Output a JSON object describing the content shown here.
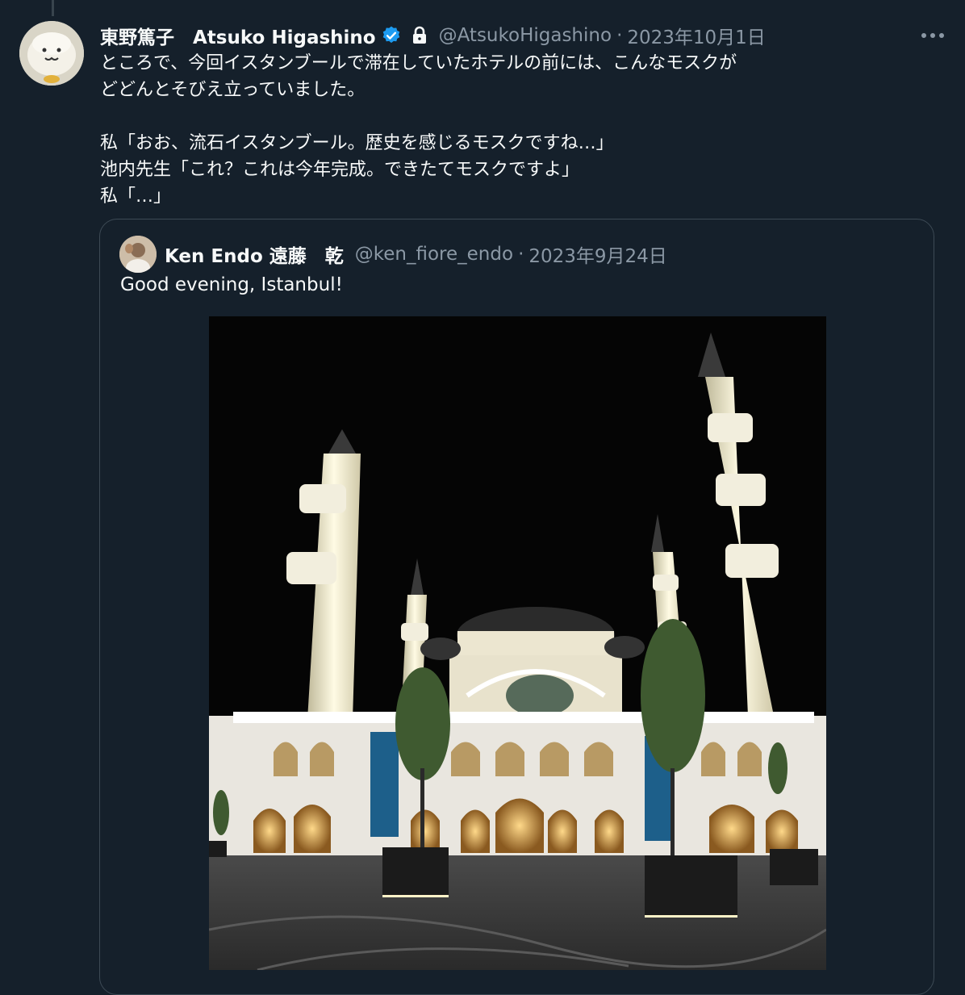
{
  "tweet": {
    "display_name": "東野篤子　Atsuko Higashino",
    "handle": "@AtsukoHigashino",
    "separator": "·",
    "date": "2023年10月1日",
    "lines": [
      "ところで、今回イスタンブールで滞在していたホテルの前には、こんなモスクが",
      "どどんとそびえ立っていました。",
      "",
      "私「おお、流石イスタンブール。歴史を感じるモスクですね…」",
      "池内先生「これ？これは今年完成。できたてモスクですよ」",
      "私「…」"
    ],
    "avatar_icon": "character-avatar-icon",
    "verified_icon": "verified-badge-icon",
    "lock_icon": "lock-icon",
    "more_icon": "more-options-icon"
  },
  "quoted_tweet": {
    "display_name": "Ken Endo 遠藤　乾",
    "handle": "@ken_fiore_endo",
    "separator": "·",
    "date": "2023年9月24日",
    "text": "Good evening, Istanbul!",
    "avatar_icon": "user-avatar-icon",
    "image_subject": "mosque-at-night-photo"
  },
  "colors": {
    "background": "#15202b",
    "text": "#f7f9f9",
    "secondary_text": "#8b98a5",
    "border": "#3d4a55",
    "verified_blue": "#1d9bf0"
  }
}
